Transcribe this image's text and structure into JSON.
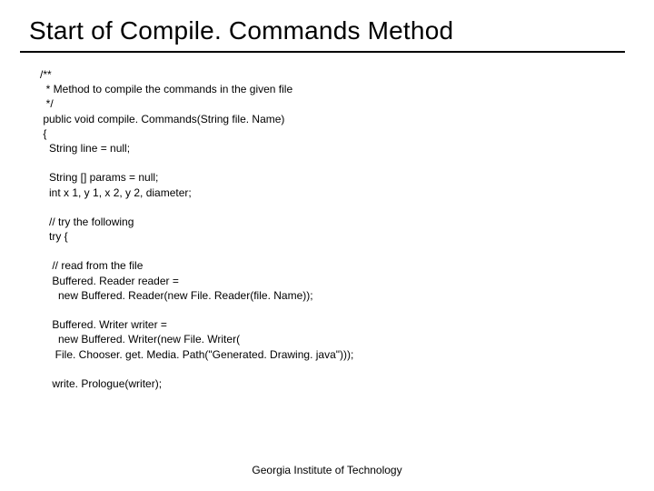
{
  "title": "Start of Compile. Commands Method",
  "code": "/**\n  * Method to compile the commands in the given file\n  */\n public void compile. Commands(String file. Name)\n {\n   String line = null;\n\n   String [] params = null;\n   int x 1, y 1, x 2, y 2, diameter;\n\n   // try the following\n   try {\n\n    // read from the file\n    Buffered. Reader reader =\n      new Buffered. Reader(new File. Reader(file. Name));\n\n    Buffered. Writer writer =\n      new Buffered. Writer(new File. Writer(\n     File. Chooser. get. Media. Path(\"Generated. Drawing. java\")));\n\n    write. Prologue(writer);",
  "footer": "Georgia Institute of Technology"
}
